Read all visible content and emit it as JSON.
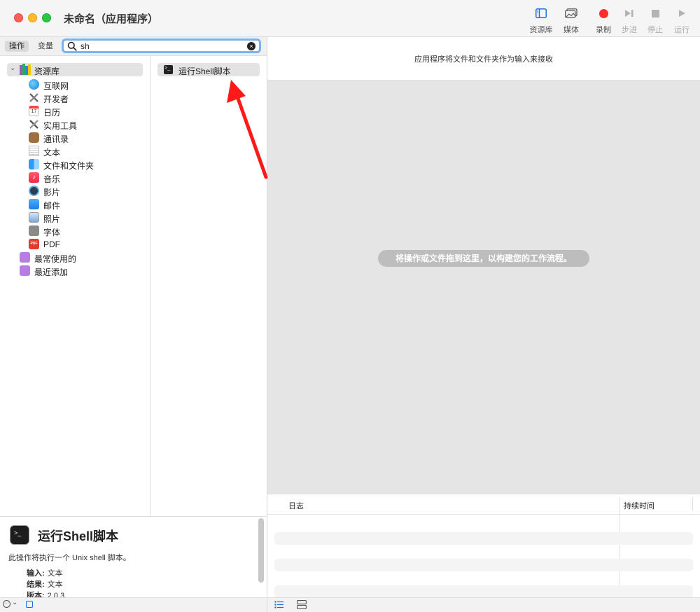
{
  "window": {
    "title": "未命名（应用程序）"
  },
  "toolbar": {
    "library": "资源库",
    "media": "媒体",
    "record": "录制",
    "step": "步进",
    "stop": "停止",
    "run": "运行"
  },
  "left": {
    "tabs": {
      "actions": "操作",
      "variables": "变量"
    },
    "search": {
      "value": "sh",
      "clear": "×"
    },
    "library_root": "资源库",
    "library_items": [
      "互联网",
      "开发者",
      "日历",
      "实用工具",
      "通讯录",
      "文本",
      "文件和文件夹",
      "音乐",
      "影片",
      "邮件",
      "照片",
      "字体",
      "PDF"
    ],
    "smart_groups": [
      "最常使用的",
      "最近添加"
    ],
    "results": [
      "运行Shell脚本"
    ],
    "description": {
      "title": "运行Shell脚本",
      "text": "此操作将执行一个 Unix shell 脚本。",
      "input_label": "输入:",
      "input_value": "文本",
      "result_label": "结果:",
      "result_value": "文本",
      "version_label": "版本:",
      "version_value": "2.0.3"
    }
  },
  "right": {
    "input_header": "应用程序将文件和文件夹作为输入来接收",
    "drop_hint": "将操作或文件拖到这里，以构建您的工作流程。",
    "log": {
      "col_log": "日志",
      "col_duration": "持续时间"
    }
  },
  "colors": {
    "record": "#ff2d2d",
    "accent": "#1e6fd9",
    "arrow": "#ff1a1a"
  }
}
